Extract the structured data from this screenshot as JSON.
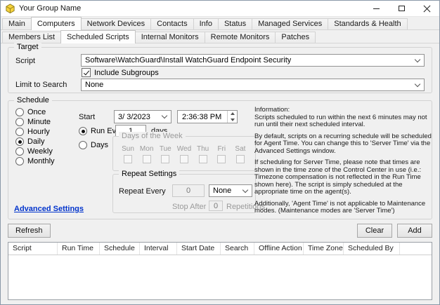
{
  "window": {
    "title": "Your Group Name"
  },
  "tabs_main": [
    "Main",
    "Computers",
    "Network Devices",
    "Contacts",
    "Info",
    "Status",
    "Managed Services",
    "Standards & Health"
  ],
  "active_tab": "Computers",
  "tabs_sub": [
    "Members List",
    "Scheduled Scripts",
    "Internal Monitors",
    "Remote Monitors",
    "Patches"
  ],
  "active_subtab": "Scheduled Scripts",
  "target": {
    "legend": "Target",
    "script_label": "Script",
    "script_value": "Software\\WatchGuard\\Install WatchGuard Endpoint Security",
    "include_subgroups": "Include Subgroups",
    "limit_label": "Limit to Search",
    "limit_value": "None"
  },
  "schedule": {
    "legend": "Schedule",
    "frequencies": [
      "Once",
      "Minute",
      "Hourly",
      "Daily",
      "Weekly",
      "Monthly"
    ],
    "selected_frequency": "Daily",
    "start_label": "Start",
    "start_date": "3/ 3/2023",
    "start_time": "2:36:38 PM",
    "run_every_label": "Run Every",
    "run_every_value": "1",
    "run_every_unit": "days",
    "days_label": "Days",
    "days_of_week_legend": "Days of the Week",
    "days_of_week": [
      "Sun",
      "Mon",
      "Tue",
      "Wed",
      "Thu",
      "Fri",
      "Sat"
    ],
    "repeat": {
      "legend": "Repeat Settings",
      "repeat_every_label": "Repeat Every",
      "repeat_every_value": "0",
      "repeat_unit": "None",
      "stop_after_label": "Stop After",
      "stop_after_value": "0",
      "repetitions_label": "Repetitions"
    },
    "info_title": "Information:",
    "info_paragraphs": [
      "Scripts scheduled to run within the next 6 minutes may not run until their next scheduled interval.",
      "By default, scripts on a recurring schedule will be scheduled for Agent Time. You can change this to 'Server Time' via the Advanced Settings window.",
      "If scheduling for Server Time, please note that times are shown in the time zone of the Control Center in use (i.e.: Timezone compensation is not reflected in the Run Time shown here). The script is simply scheduled at the appropriate time on the agent(s).",
      "Additionally, 'Agent Time' is not applicable to Maintenance modes. (Maintenance modes are 'Server Time')"
    ],
    "advanced_settings": "Advanced Settings"
  },
  "buttons": {
    "refresh": "Refresh",
    "clear": "Clear",
    "add": "Add"
  },
  "table": {
    "columns": [
      "Script",
      "Run Time",
      "Schedule",
      "Interval",
      "Start Date",
      "Search",
      "Offline Action",
      "Time Zone",
      "Scheduled By"
    ],
    "rows": []
  }
}
